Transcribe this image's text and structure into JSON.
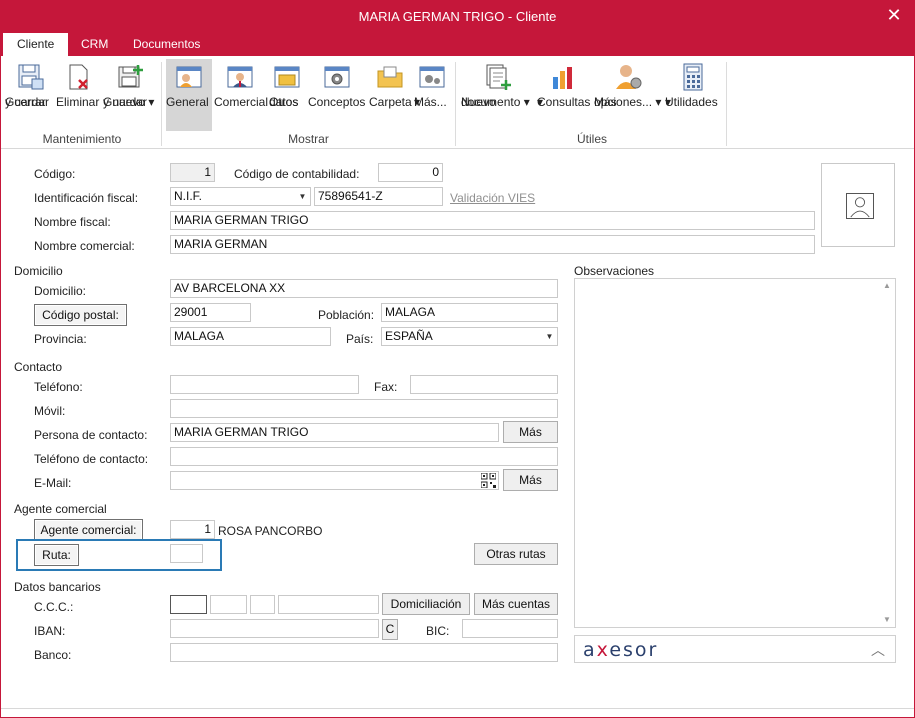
{
  "window": {
    "title": "MARIA GERMAN TRIGO - Cliente",
    "close_glyph": "✕"
  },
  "tabs": [
    {
      "label": "Cliente"
    },
    {
      "label": "CRM"
    },
    {
      "label": "Documentos"
    }
  ],
  "ribbon": {
    "guardar_cerrar": [
      "Guardar",
      "y cerrar"
    ],
    "eliminar": "Eliminar",
    "guardar_nuevo": [
      "Guardar",
      "y nuevo ▾"
    ],
    "general": "General",
    "comercial": "Comercial",
    "otros_datos": [
      "Otros",
      "datos"
    ],
    "conceptos": "Conceptos",
    "carpeta": "Carpeta",
    "mas": [
      "Más...",
      "▾"
    ],
    "nuevo_documento": [
      "Nuevo",
      "documento ▾"
    ],
    "consultas": [
      "Consultas",
      "▾"
    ],
    "mas_opciones": [
      "Más",
      "opciones... ▾"
    ],
    "utilidades": [
      "Utilidades",
      "▾"
    ],
    "groups": {
      "mantenimiento": "Mantenimiento",
      "mostrar": "Mostrar",
      "utiles": "Útiles"
    }
  },
  "form": {
    "codigo_label": "Código:",
    "codigo": "1",
    "cod_contab_label": "Código de contabilidad:",
    "cod_contab": "0",
    "ident_label": "Identificación fiscal:",
    "ident_tipo": "N.I.F.",
    "ident_num": "75896541-Z",
    "validacion": "Validación VIES",
    "nombre_fiscal_label": "Nombre fiscal:",
    "nombre_fiscal": "MARIA GERMAN TRIGO",
    "nombre_comercial_label": "Nombre comercial:",
    "nombre_comercial": "MARIA GERMAN",
    "domicilio_section": "Domicilio",
    "domicilio_label": "Domicilio:",
    "domicilio": "AV BARCELONA XX",
    "cp_button": "Código postal:",
    "cp": "29001",
    "poblacion_label": "Población:",
    "poblacion": "MALAGA",
    "provincia_label": "Provincia:",
    "provincia": "MALAGA",
    "pais_label": "País:",
    "pais": "ESPAÑA",
    "contacto_section": "Contacto",
    "telefono_label": "Teléfono:",
    "fax_label": "Fax:",
    "movil_label": "Móvil:",
    "persona_label": "Persona de contacto:",
    "persona": "MARIA GERMAN TRIGO",
    "mas_label": "Más",
    "tel_contacto_label": "Teléfono de contacto:",
    "email_label": "E-Mail:",
    "agente_section": "Agente comercial",
    "agente_button": "Agente comercial:",
    "agente_num": "1",
    "agente_nombre": "ROSA PANCORBO",
    "ruta_button": "Ruta:",
    "otras_rutas": "Otras rutas",
    "bancarios_section": "Datos bancarios",
    "ccc_label": "C.C.C.:",
    "domiciliacion": "Domiciliación",
    "mas_cuentas": "Más cuentas",
    "iban_label": "IBAN:",
    "iban_c": "C",
    "bic_label": "BIC:",
    "banco_label": "Banco:",
    "observaciones_label": "Observaciones",
    "axesor_pre": "a",
    "axesor_x": "x",
    "axesor_post": "esor"
  }
}
